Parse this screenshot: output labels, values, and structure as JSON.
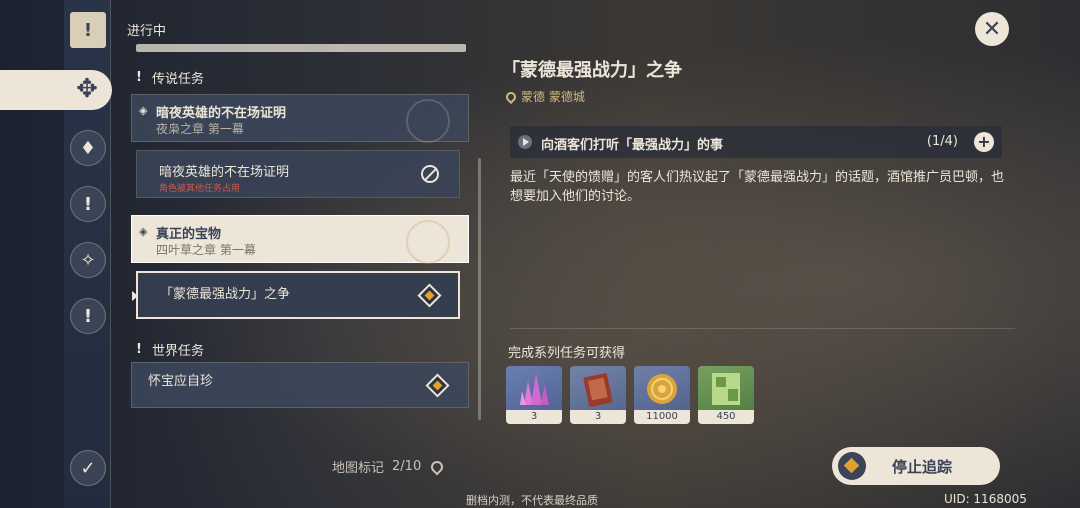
{
  "rail": {
    "icons": [
      "quest-book-icon",
      "quest-diamond-icon",
      "archon-quest-icon",
      "legend-quest-icon",
      "story-quest-icon",
      "world-quest-icon",
      "quest-settings-icon"
    ]
  },
  "list": {
    "section_title": "进行中",
    "categories": {
      "legend": "传说任务",
      "world": "世界任务"
    },
    "quests": [
      {
        "title": "暗夜英雄的不在场证明",
        "chapter": "夜枭之章 第一幕"
      },
      {
        "title": "真正的宝物",
        "chapter": "四叶草之章 第一幕"
      }
    ],
    "subquests": [
      {
        "title": "暗夜英雄的不在场证明",
        "note": "角色被其他任务占用"
      },
      {
        "title": "「蒙德最强战力」之争"
      }
    ],
    "world_items": [
      {
        "title": "怀宝应自珍"
      }
    ],
    "map_marker_label": "地图标记",
    "map_marker_count": "2/10"
  },
  "detail": {
    "title": "「蒙德最强战力」之争",
    "location": "蒙德 蒙德城",
    "objective": {
      "text": "向酒客们打听「最强战力」的事",
      "progress": "(1/4)"
    },
    "description": "最近「天使的馈赠」的客人们热议起了「蒙德最强战力」的话题，酒馆推广员巴顿，也想要加入他们的讨论。",
    "rewards_label": "完成系列任务可获得",
    "rewards": [
      {
        "name": "crystal",
        "count": "3"
      },
      {
        "name": "book",
        "count": "3"
      },
      {
        "name": "mora",
        "count": "11000"
      },
      {
        "name": "exp",
        "count": "450"
      }
    ],
    "stop_tracking": "停止追踪"
  },
  "footer": {
    "note": "删档内测，不代表最终品质",
    "uid": "UID: 1168005"
  },
  "colors": {
    "cream": "#ece5d8",
    "navy": "#3b4356",
    "gold": "#d3b980",
    "accent": "#e0a22c",
    "warning": "#d0564a"
  }
}
